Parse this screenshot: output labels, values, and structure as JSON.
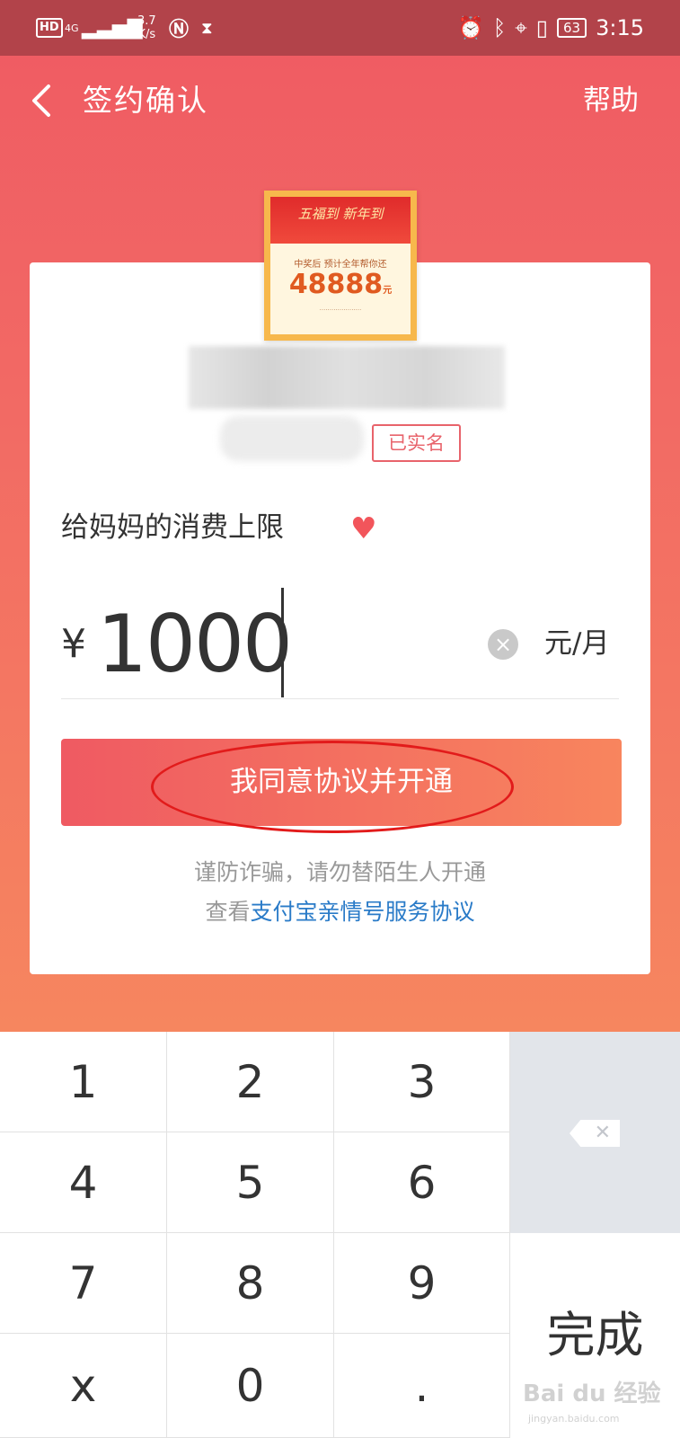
{
  "status_bar": {
    "hd": "HD",
    "network": "4G",
    "speed_value": "3.7",
    "speed_unit": "K/s",
    "battery": "63",
    "time": "3:15"
  },
  "navbar": {
    "back_icon": "chevron-left",
    "title": "签约确认",
    "help": "帮助"
  },
  "card": {
    "avatar": {
      "banner": "五福到 新年到",
      "line": "中奖后 预计全年帮你还",
      "amount": "48888",
      "unit": "元"
    },
    "verified_badge": "已实名",
    "limit_title": "给妈妈的消费上限",
    "heart_icon": "heart",
    "currency": "¥",
    "amount_value": "1000",
    "unit": "元/月",
    "agree_button": "我同意协议并开通",
    "warning": "谨防诈骗，请勿替陌生人开通",
    "agreement_prefix": "查看",
    "agreement_link": "支付宝亲情号服务协议"
  },
  "keyboard": {
    "keys": [
      "1",
      "2",
      "3",
      "4",
      "5",
      "6",
      "7",
      "8",
      "9",
      "x",
      "0",
      "."
    ],
    "delete_icon": "backspace",
    "done": "完成"
  },
  "watermark": {
    "brand": "Bai du 经验",
    "url": "jingyan.baidu.com"
  },
  "colors": {
    "gradient_top": "#ef5a63",
    "gradient_bottom": "#f6865f",
    "status_bar": "#b2434a",
    "accent_text": "#e8636b",
    "link": "#2a7bc8"
  }
}
